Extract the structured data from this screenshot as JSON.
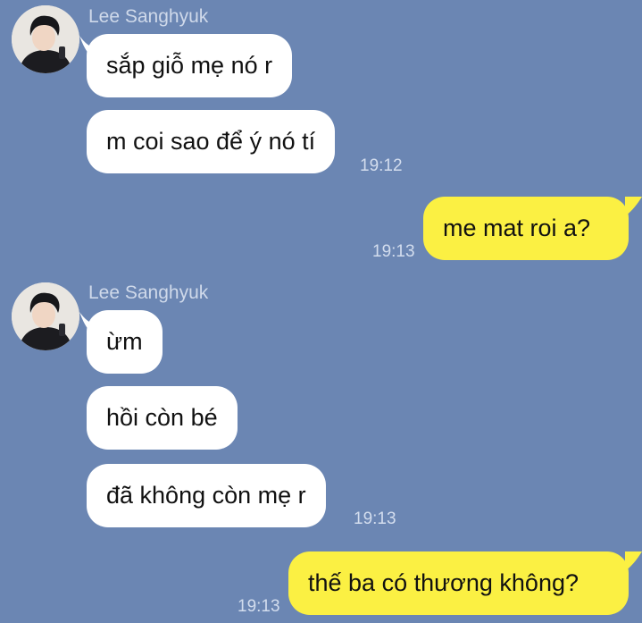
{
  "colors": {
    "background": "#6b86b3",
    "incoming_bubble": "#ffffff",
    "outgoing_bubble": "#fbf043",
    "sender_name": "#cfd9ea",
    "timestamp": "#d3ddee"
  },
  "groups": [
    {
      "sender": "Lee Sanghyuk",
      "avatar": "profile-photo",
      "messages": [
        {
          "text": "sắp giỗ mẹ nó r"
        },
        {
          "text": "m coi sao để ý nó tí",
          "time": "19:12"
        }
      ]
    },
    {
      "outgoing": true,
      "messages": [
        {
          "text": "me mat roi a?",
          "time": "19:13"
        }
      ]
    },
    {
      "sender": "Lee Sanghyuk",
      "avatar": "profile-photo",
      "messages": [
        {
          "text": "ừm"
        },
        {
          "text": "hồi còn bé"
        },
        {
          "text": "đã không còn mẹ r",
          "time": "19:13"
        }
      ]
    },
    {
      "outgoing": true,
      "messages": [
        {
          "text": "thế ba có thương không?",
          "time": "19:13"
        }
      ]
    }
  ]
}
